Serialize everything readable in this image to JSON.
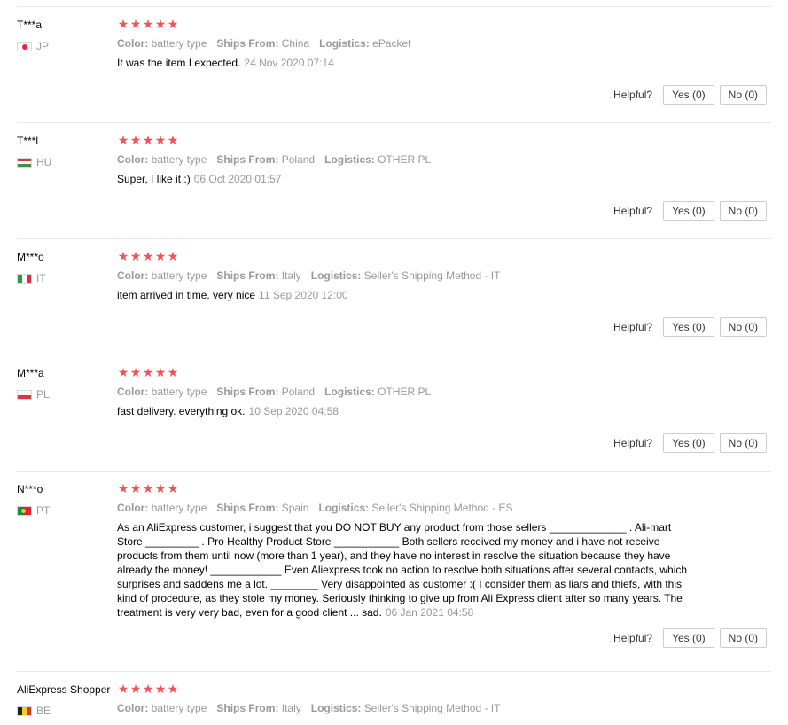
{
  "ui": {
    "helpful_label": "Helpful?",
    "color_key": "Color:",
    "ships_key": "Ships From:",
    "logistics_key": "Logistics:",
    "star_icon": "star-icon",
    "star_color": "#f0545a",
    "muted_text_color": "#999999"
  },
  "reviews": [
    {
      "user": "T***a",
      "country": "JP",
      "rating": 5,
      "color": "battery type",
      "ships_from": "China",
      "logistics": "ePacket",
      "content": "It was the item I expected.",
      "date": "24 Nov 2020 07:14",
      "yes_label": "Yes (0)",
      "no_label": "No (0)"
    },
    {
      "user": "T***l",
      "country": "HU",
      "rating": 5,
      "color": "battery type",
      "ships_from": "Poland",
      "logistics": "OTHER PL",
      "content": "Super, I like it :)",
      "date": "06 Oct 2020 01:57",
      "yes_label": "Yes (0)",
      "no_label": "No (0)"
    },
    {
      "user": "M***o",
      "country": "IT",
      "rating": 5,
      "color": "battery type",
      "ships_from": "Italy",
      "logistics": "Seller's Shipping Method - IT",
      "content": "item arrived in time. very nice",
      "date": "11 Sep 2020 12:00",
      "yes_label": "Yes (0)",
      "no_label": "No (0)"
    },
    {
      "user": "M***a",
      "country": "PL",
      "rating": 5,
      "color": "battery type",
      "ships_from": "Poland",
      "logistics": "OTHER PL",
      "content": "fast delivery. everything ok.",
      "date": "10 Sep 2020 04:58",
      "yes_label": "Yes (0)",
      "no_label": "No (0)"
    },
    {
      "user": "N***o",
      "country": "PT",
      "rating": 5,
      "color": "battery type",
      "ships_from": "Spain",
      "logistics": "Seller's Shipping Method - ES",
      "content": "As an AliExpress customer, i suggest that you DO NOT BUY any product from those sellers _____________ . Ali-mart Store _________ . Pro Healthy Product Store ___________ Both sellers received my money and i have not receive products from them until now (more than 1 year), and they have no interest in resolve the situation because they have already the money! ____________ Even Aliexpress took no action to resolve both situations after several contacts, which surprises and saddens me a lot. ________ Very disappointed as customer :( I consider them as liars and thiefs, with this kind of procedure, as they stole my money. Seriously thinking to give up from Ali Express client after so many years. The treatment is very very bad, even for a good client ... sad.",
      "date": "06 Jan 2021 04:58",
      "yes_label": "Yes (0)",
      "no_label": "No (0)"
    },
    {
      "user": "AliExpress Shopper",
      "country": "BE",
      "rating": 5,
      "color": "battery type",
      "ships_from": "Italy",
      "logistics": "Seller's Shipping Method - IT",
      "content": "",
      "date": "",
      "yes_label": "",
      "no_label": ""
    }
  ]
}
